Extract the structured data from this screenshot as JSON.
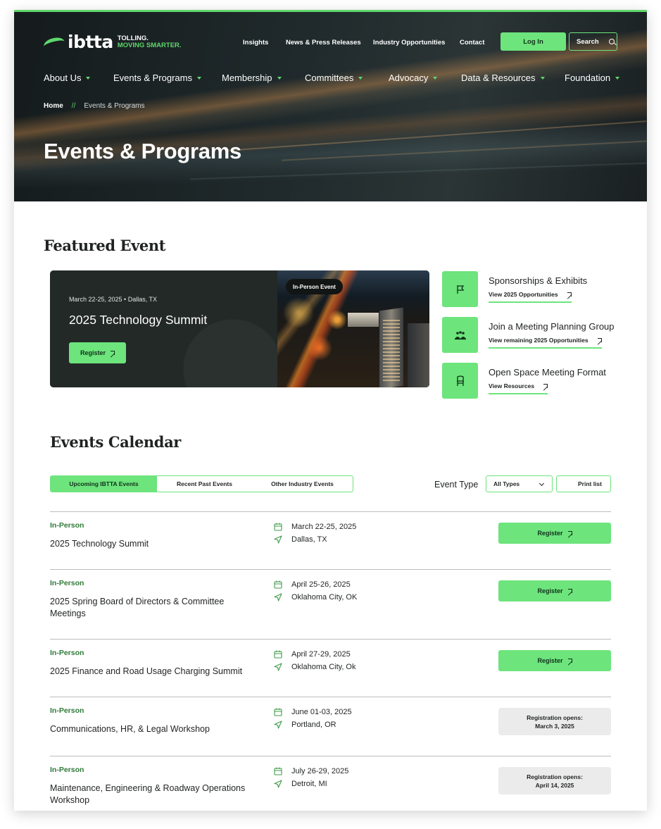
{
  "brand": {
    "logo_word": "ibtta",
    "tag_line1": "TOLLING.",
    "tag_line2": "MOVING SMARTER.",
    "accent": "#6de47c",
    "dark": "#1f2524"
  },
  "utility_nav": [
    "Insights",
    "News & Press Releases",
    "Industry Opportunities",
    "Contact"
  ],
  "login_label": "Log In",
  "search_label": "Search",
  "main_nav": [
    "About Us",
    "Events & Programs",
    "Membership",
    "Committees",
    "Advocacy",
    "Data & Resources",
    "Foundation"
  ],
  "breadcrumb": {
    "home": "Home",
    "separator": "//",
    "current": "Events & Programs"
  },
  "hero_title": "Events & Programs",
  "featured": {
    "section_title": "Featured Event",
    "date_location": "March 22-25, 2025 • Dallas, TX",
    "title": "2025 Technology Summit",
    "register_label": "Register",
    "badge": "In-Person Event"
  },
  "side_links": [
    {
      "title": "Sponsorships & Exhibits",
      "link": "View 2025 Opportunities",
      "icon": "flag-icon"
    },
    {
      "title": "Join a Meeting Planning Group",
      "link": "View remaining 2025 Opportunities",
      "icon": "group-icon"
    },
    {
      "title": "Open Space Meeting Format",
      "link": "View Resources",
      "icon": "chair-icon"
    }
  ],
  "calendar": {
    "section_title": "Events Calendar",
    "tabs": [
      "Upcoming IBTTA Events",
      "Recent Past Events",
      "Other Industry Events"
    ],
    "filter_label": "Event Type",
    "filter_value": "All Types",
    "print_label": "Print list",
    "events": [
      {
        "type": "In-Person",
        "title": "2025 Technology Summit",
        "date": "March 22-25, 2025",
        "location": "Dallas, TX",
        "action": "Register"
      },
      {
        "type": "In-Person",
        "title": "2025 Spring Board of Directors & Committee Meetings",
        "date": "April 25-26, 2025",
        "location": "Oklahoma City, OK",
        "action": "Register"
      },
      {
        "type": "In-Person",
        "title": "2025 Finance and Road Usage Charging Summit",
        "date": "April 27-29, 2025",
        "location": "Oklahoma City, Ok",
        "action": "Register"
      },
      {
        "type": "In-Person",
        "title": "Communications, HR, & Legal Workshop",
        "date": "June 01-03, 2025",
        "location": "Portland, OR",
        "opens_label": "Registration opens:",
        "opens_date": "March 3, 2025"
      },
      {
        "type": "In-Person",
        "title": "Maintenance, Engineering & Roadway Operations Workshop",
        "date": "July 26-29, 2025",
        "location": "Detroit, MI",
        "opens_label": "Registration opens:",
        "opens_date": "April 14, 2025"
      }
    ]
  }
}
